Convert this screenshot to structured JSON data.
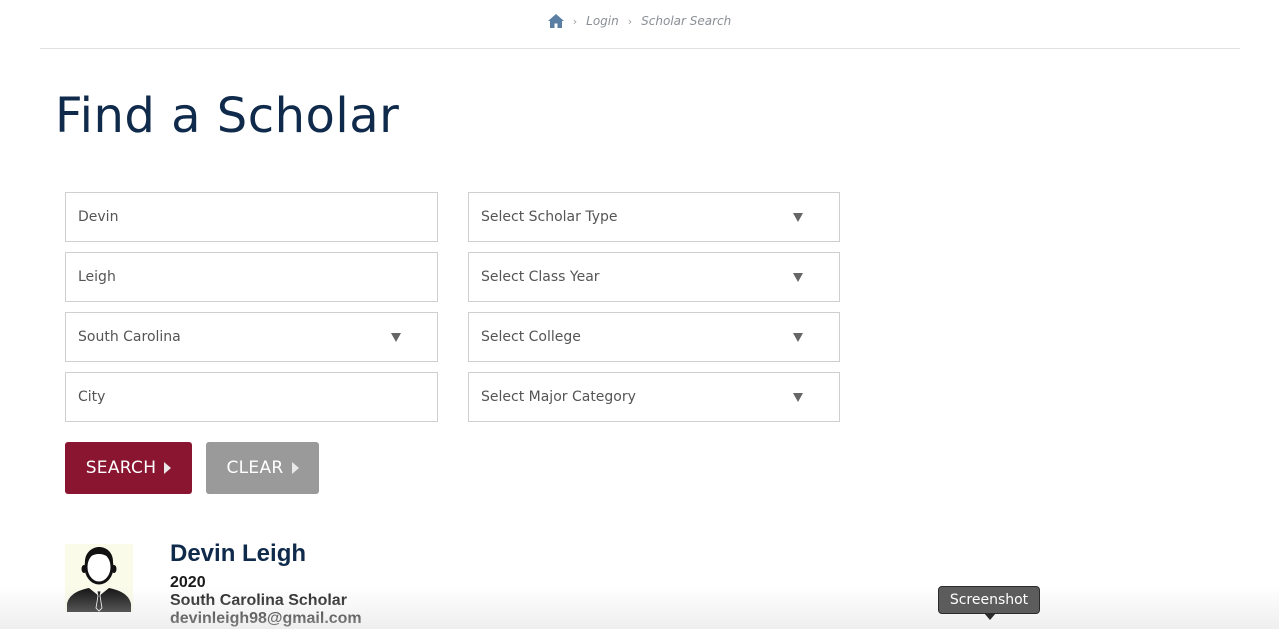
{
  "breadcrumb": {
    "home_icon": "home-icon",
    "separator": "›",
    "items": [
      "Login",
      "Scholar Search"
    ]
  },
  "page": {
    "title": "Find a Scholar"
  },
  "form": {
    "first_name": "Devin",
    "last_name": "Leigh",
    "state": "South Carolina",
    "city_placeholder": "City",
    "scholar_type": "Select Scholar Type",
    "class_year": "Select Class Year",
    "college": "Select College",
    "major_category": "Select Major Category"
  },
  "buttons": {
    "search": "SEARCH",
    "clear": "CLEAR"
  },
  "result": {
    "name": "Devin Leigh",
    "year": "2020",
    "scholar_type": "South Carolina Scholar",
    "email": "devinleigh98@gmail.com",
    "avatar_icon": "person-avatar-icon"
  },
  "tooltip": {
    "label": "Screenshot"
  },
  "colors": {
    "title": "#0f2a4a",
    "search_button": "#8a1531",
    "clear_button": "#9a9a9a"
  }
}
